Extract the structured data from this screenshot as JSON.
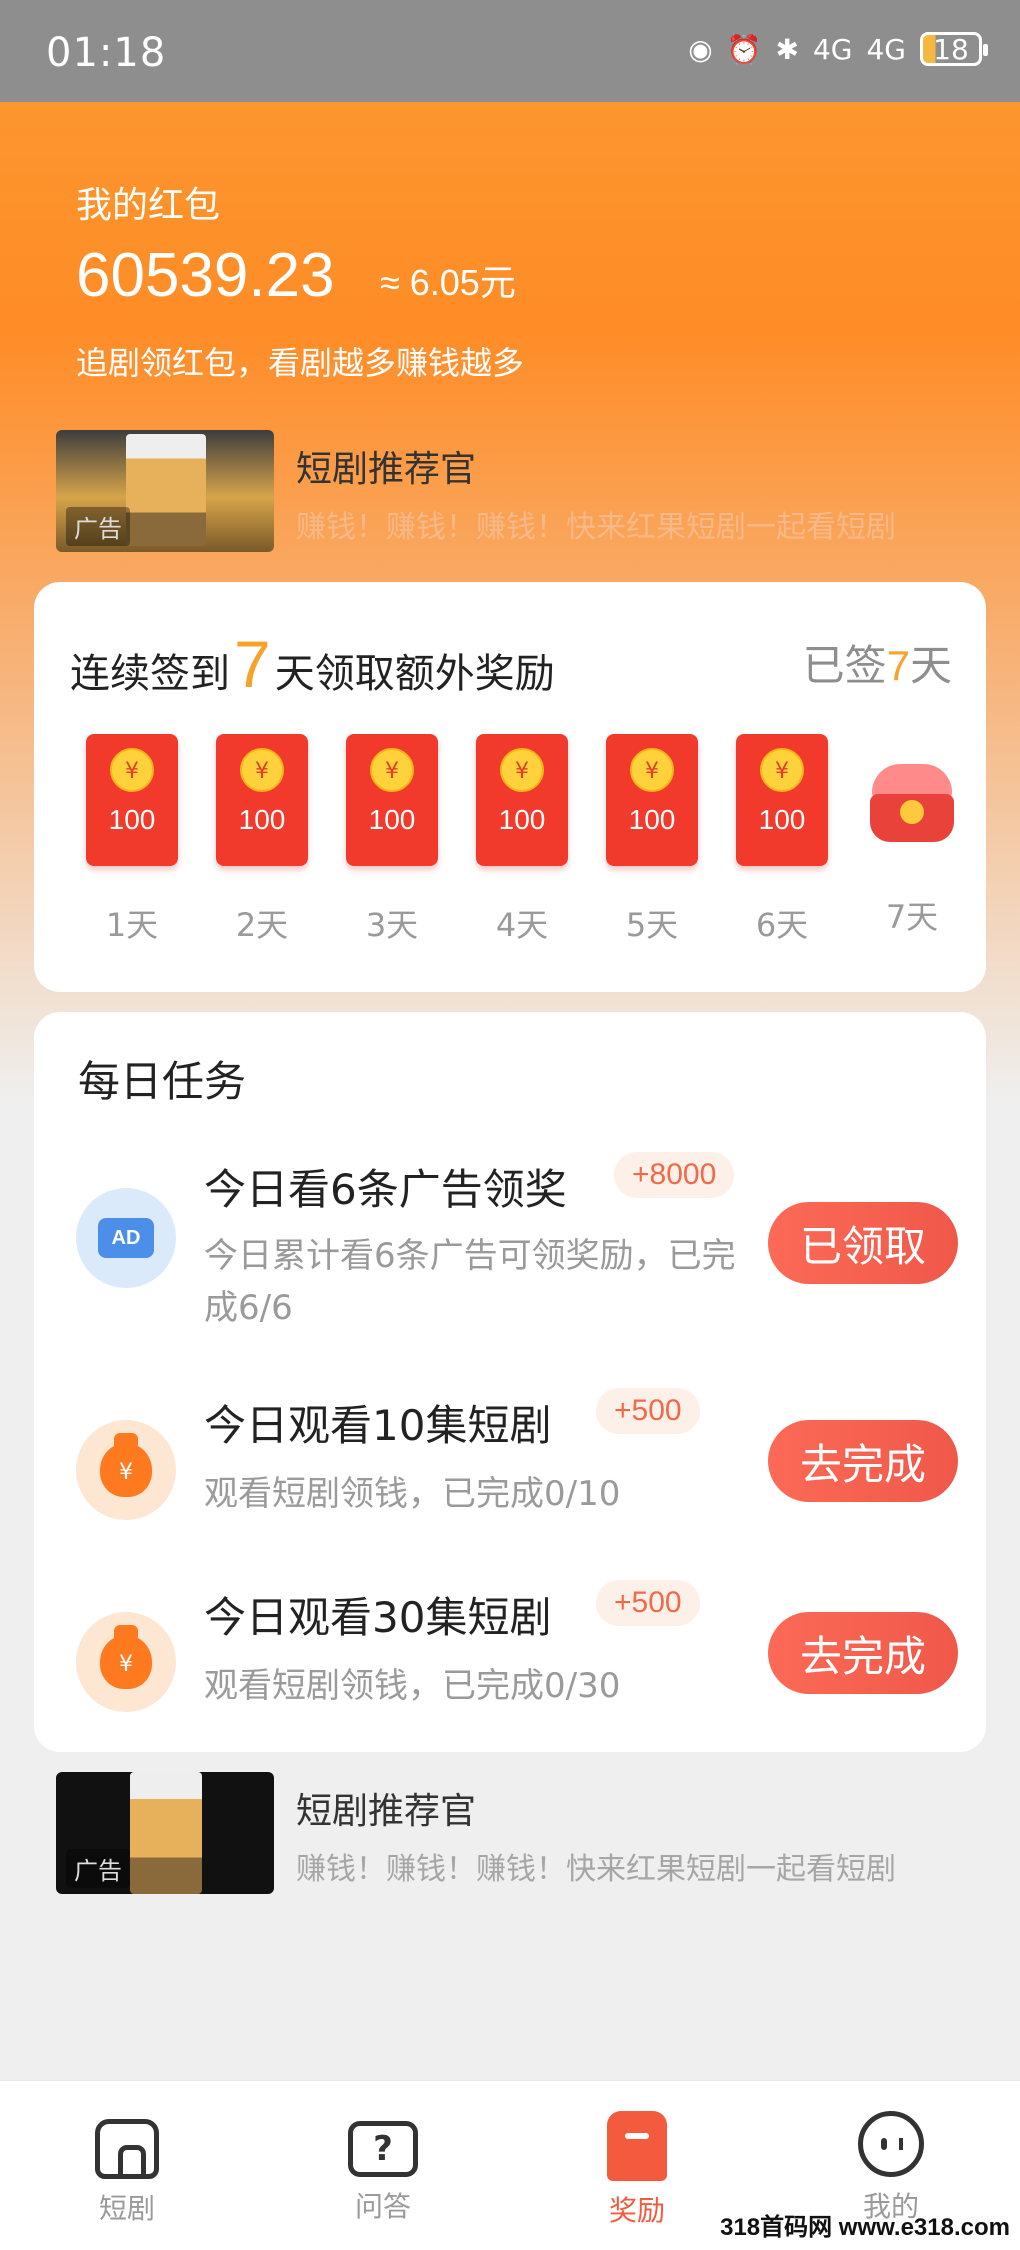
{
  "status_bar": {
    "time": "01:18",
    "battery": "18",
    "network": "4G"
  },
  "header": {
    "label": "我的红包",
    "amount": "60539.23",
    "approx": "≈ 6.05元",
    "slogan": "追剧领红包，看剧越多赚钱越多"
  },
  "ad_top": {
    "title": "短剧推荐官",
    "desc": "赚钱！赚钱！赚钱！快来红果短剧一起看短剧",
    "tag": "广告"
  },
  "signin": {
    "title_prefix": "连续签到",
    "title_num": "7",
    "title_suffix": "天领取额外奖励",
    "status_prefix": "已签",
    "status_days": "7",
    "status_suffix": "天",
    "days": [
      {
        "label": "1天",
        "amount": "100"
      },
      {
        "label": "2天",
        "amount": "100"
      },
      {
        "label": "3天",
        "amount": "100"
      },
      {
        "label": "4天",
        "amount": "100"
      },
      {
        "label": "5天",
        "amount": "100"
      },
      {
        "label": "6天",
        "amount": "100"
      },
      {
        "label": "7天"
      }
    ],
    "coin_symbol": "¥"
  },
  "tasks": {
    "title": "每日任务",
    "items": [
      {
        "icon": "ad-tv-icon",
        "name": "今日看6条广告领奖",
        "reward": "+8000",
        "desc": "今日累计看6条广告可领奖励，已完成6/6",
        "button": "已领取"
      },
      {
        "icon": "money-bag-icon",
        "name": "今日观看10集短剧",
        "reward": "+500",
        "desc": "观看短剧领钱，已完成0/10",
        "button": "去完成"
      },
      {
        "icon": "money-bag-icon",
        "name": "今日观看30集短剧",
        "reward": "+500",
        "desc": "观看短剧领钱，已完成0/30",
        "button": "去完成"
      }
    ]
  },
  "ad_bottom": {
    "title": "短剧推荐官",
    "desc": "赚钱！赚钱！赚钱！快来红果短剧一起看短剧",
    "tag": "广告"
  },
  "nav": {
    "items": [
      {
        "label": "短剧"
      },
      {
        "label": "问答"
      },
      {
        "label": "奖励",
        "active": true
      },
      {
        "label": "我的"
      }
    ]
  },
  "watermark": "318首码网 www.e318.com",
  "colors": {
    "accent": "#ff8c26",
    "red": "#f23a2c",
    "button": "#f35a3e",
    "gold": "#f7a32b"
  }
}
